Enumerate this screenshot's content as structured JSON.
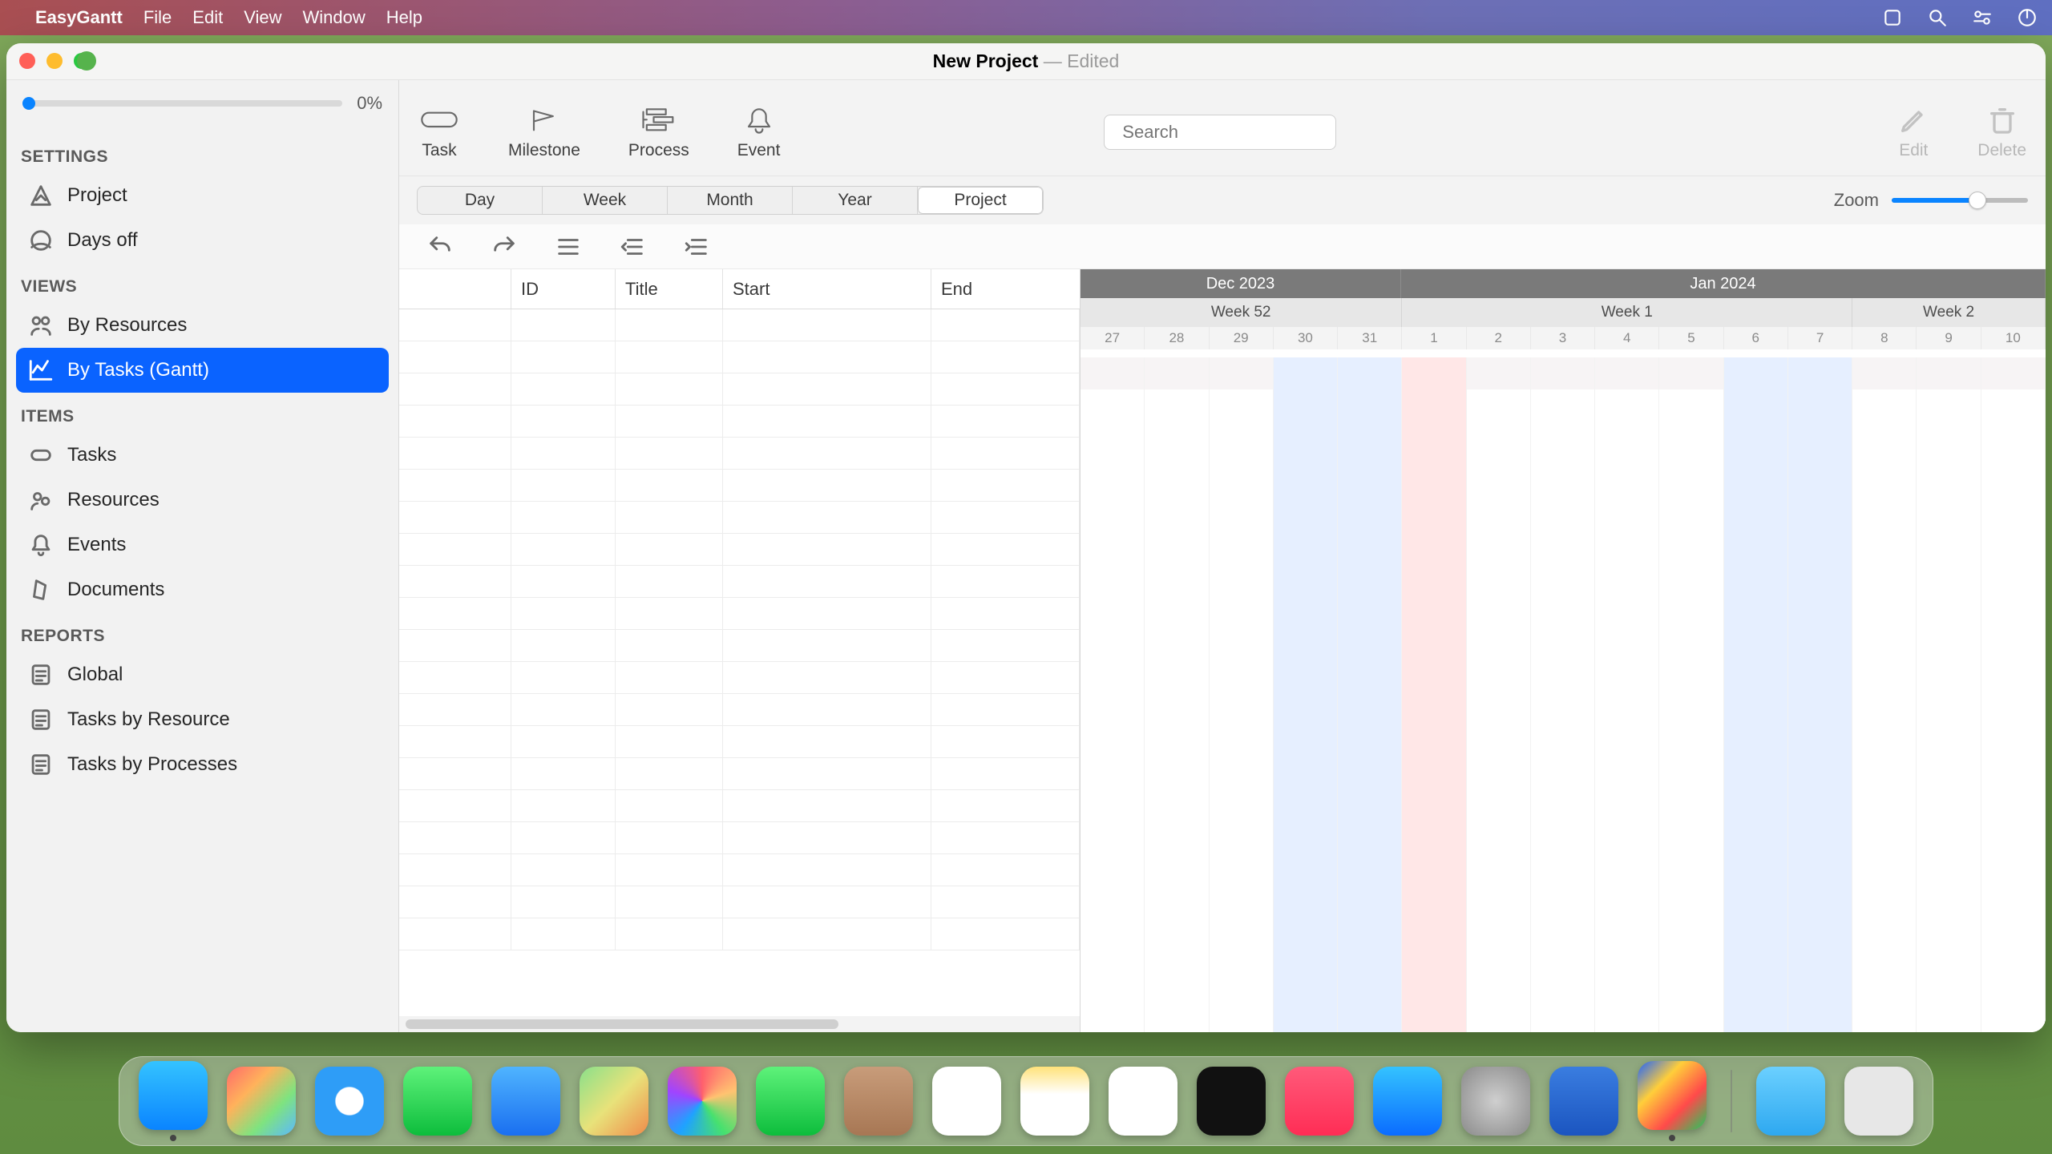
{
  "menubar": {
    "app_name": "EasyGantt",
    "menus": [
      "File",
      "Edit",
      "View",
      "Window",
      "Help"
    ]
  },
  "window": {
    "title_main": "New Project",
    "title_sep": " — ",
    "title_status": "Edited"
  },
  "sidebar": {
    "progress_pct": "0%",
    "sections": {
      "settings": {
        "label": "SETTINGS",
        "items": [
          {
            "label": "Project",
            "icon": "project"
          },
          {
            "label": "Days off",
            "icon": "daysoff"
          }
        ]
      },
      "views": {
        "label": "VIEWS",
        "items": [
          {
            "label": "By Resources",
            "icon": "byres"
          },
          {
            "label": "By Tasks (Gantt)",
            "icon": "bygantt",
            "active": true
          }
        ]
      },
      "items": {
        "label": "ITEMS",
        "items": [
          {
            "label": "Tasks",
            "icon": "tasks"
          },
          {
            "label": "Resources",
            "icon": "resources"
          },
          {
            "label": "Events",
            "icon": "events"
          },
          {
            "label": "Documents",
            "icon": "documents"
          }
        ]
      },
      "reports": {
        "label": "REPORTS",
        "items": [
          {
            "label": "Global",
            "icon": "report"
          },
          {
            "label": "Tasks by Resource",
            "icon": "report"
          },
          {
            "label": "Tasks by Processes",
            "icon": "report"
          }
        ]
      }
    }
  },
  "toolbar": {
    "buttons": [
      {
        "label": "Task",
        "icon": "task"
      },
      {
        "label": "Milestone",
        "icon": "milestone"
      },
      {
        "label": "Process",
        "icon": "process"
      },
      {
        "label": "Event",
        "icon": "event"
      }
    ],
    "search_placeholder": "Search",
    "edit_label": "Edit",
    "delete_label": "Delete"
  },
  "timescale": {
    "segments": [
      "Day",
      "Week",
      "Month",
      "Year",
      "Project"
    ],
    "active": "Project",
    "zoom_label": "Zoom"
  },
  "grid": {
    "columns": [
      "",
      "ID",
      "Title",
      "Start",
      "End"
    ],
    "row_count": 20
  },
  "gantt": {
    "months": [
      "Dec 2023",
      "Jan 2024"
    ],
    "weeks": [
      {
        "label": "Week 52",
        "span": 5
      },
      {
        "label": "Week 1",
        "span": 7
      },
      {
        "label": "Week 2",
        "span": 3
      }
    ],
    "days": [
      {
        "n": "27",
        "cls": ""
      },
      {
        "n": "28",
        "cls": ""
      },
      {
        "n": "29",
        "cls": ""
      },
      {
        "n": "30",
        "cls": "we"
      },
      {
        "n": "31",
        "cls": "we"
      },
      {
        "n": "1",
        "cls": "hol"
      },
      {
        "n": "2",
        "cls": ""
      },
      {
        "n": "3",
        "cls": ""
      },
      {
        "n": "4",
        "cls": ""
      },
      {
        "n": "5",
        "cls": ""
      },
      {
        "n": "6",
        "cls": "we"
      },
      {
        "n": "7",
        "cls": "we"
      },
      {
        "n": "8",
        "cls": ""
      },
      {
        "n": "9",
        "cls": ""
      },
      {
        "n": "10",
        "cls": ""
      }
    ]
  },
  "dock": {
    "apps": [
      {
        "name": "finder",
        "bg": "linear-gradient(180deg,#34c3ff,#0a84ff)",
        "running": true
      },
      {
        "name": "launchpad",
        "bg": "linear-gradient(135deg,#ff6a6a,#ffb25b,#7fe37f,#5bb8ff)"
      },
      {
        "name": "safari",
        "bg": "radial-gradient(circle at 50% 50%,#fff 28%,#2e9df7 30%)"
      },
      {
        "name": "messages",
        "bg": "linear-gradient(180deg,#5ef27a,#0dbd3c)"
      },
      {
        "name": "mail",
        "bg": "linear-gradient(180deg,#4fb4ff,#1a6ff0)"
      },
      {
        "name": "maps",
        "bg": "linear-gradient(135deg,#8ae08a,#e8e27a,#f08a4a)"
      },
      {
        "name": "photos",
        "bg": "conic-gradient(#ff5f6d,#ffc371,#47e16e,#1fa2ff,#a044ff,#ff5f6d)"
      },
      {
        "name": "facetime",
        "bg": "linear-gradient(180deg,#5ef27a,#0dbd3c)"
      },
      {
        "name": "contacts",
        "bg": "linear-gradient(180deg,#c89c7a,#a77754)"
      },
      {
        "name": "reminders",
        "bg": "#fff"
      },
      {
        "name": "notes",
        "bg": "linear-gradient(180deg,#ffe27a,#fff 40%)"
      },
      {
        "name": "freeform",
        "bg": "#fff"
      },
      {
        "name": "appletv",
        "bg": "#111"
      },
      {
        "name": "music",
        "bg": "linear-gradient(180deg,#ff5a7a,#ff2d55)"
      },
      {
        "name": "appstore",
        "bg": "linear-gradient(180deg,#34c3ff,#0a6cff)"
      },
      {
        "name": "settings",
        "bg": "radial-gradient(circle,#cfcfcf,#8a8a8a)"
      },
      {
        "name": "easygantt",
        "bg": "linear-gradient(180deg,#3a7de0,#1b55c0)"
      },
      {
        "name": "keynote-like",
        "bg": "linear-gradient(135deg,#1e62ff,#ffce3a,#ff4a4a,#1ecb5d)",
        "running": true
      }
    ],
    "right": [
      {
        "name": "downloads",
        "bg": "linear-gradient(180deg,#6bd0ff,#2ea8f0)"
      },
      {
        "name": "trash",
        "bg": "#e7e7e7"
      }
    ]
  }
}
